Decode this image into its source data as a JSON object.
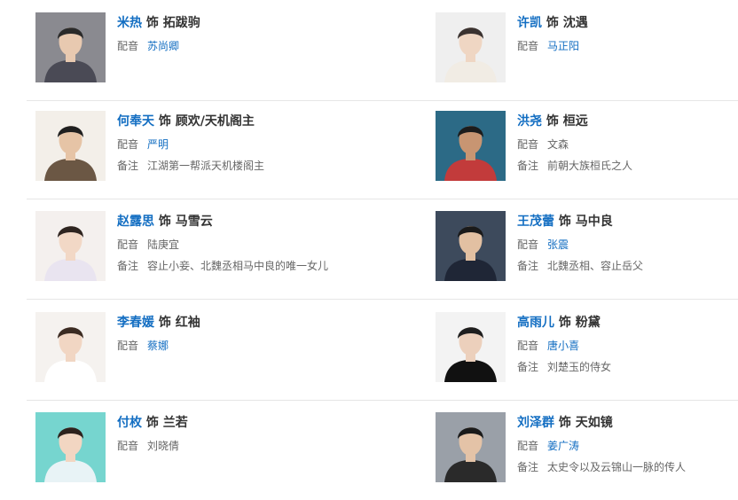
{
  "cast": [
    {
      "actor": "米热",
      "as": "饰",
      "role": "拓跋驹",
      "voice_label": "配音",
      "voice": "苏尚卿",
      "voice_link": true,
      "note_label": "",
      "note": "",
      "bg": "#8a8a90",
      "skin": "#e8c9b0",
      "hair": "#2a2a2a",
      "cloth": "#4a4a55"
    },
    {
      "actor": "许凯",
      "as": "饰",
      "role": "沈遇",
      "voice_label": "配音",
      "voice": "马正阳",
      "voice_link": true,
      "note_label": "",
      "note": "",
      "bg": "#efefef",
      "skin": "#efd6c3",
      "hair": "#3a3230",
      "cloth": "#f1ece4"
    },
    {
      "actor": "何奉天",
      "as": "饰",
      "role": "顾欢/天机阁主",
      "voice_label": "配音",
      "voice": "严明",
      "voice_link": true,
      "note_label": "备注",
      "note": "江湖第一帮派天机楼阁主",
      "bg": "#f3efe9",
      "skin": "#e6c4a6",
      "hair": "#1f1f1f",
      "cloth": "#6b5744"
    },
    {
      "actor": "洪尧",
      "as": "饰",
      "role": "桓远",
      "voice_label": "配音",
      "voice": "文森",
      "voice_link": false,
      "note_label": "备注",
      "note": "前朝大族桓氏之人",
      "bg": "#2c6a86",
      "skin": "#c89572",
      "hair": "#1c1c1c",
      "cloth": "#c23b3b"
    },
    {
      "actor": "赵露思",
      "as": "饰",
      "role": "马雪云",
      "voice_label": "配音",
      "voice": "陆庚宜",
      "voice_link": false,
      "note_label": "备注",
      "note": "容止小妾、北魏丞相马中良的唯一女儿",
      "bg": "#f4f0ee",
      "skin": "#f2d8c6",
      "hair": "#2e2420",
      "cloth": "#e9e4f0"
    },
    {
      "actor": "王茂蕾",
      "as": "饰",
      "role": "马中良",
      "voice_label": "配音",
      "voice": "张震",
      "voice_link": true,
      "note_label": "备注",
      "note": "北魏丞相、容止岳父",
      "bg": "#3d4a5c",
      "skin": "#e2c0a2",
      "hair": "#1a1a1a",
      "cloth": "#1f2636"
    },
    {
      "actor": "李春媛",
      "as": "饰",
      "role": "红袖",
      "voice_label": "配音",
      "voice": "蔡娜",
      "voice_link": true,
      "note_label": "",
      "note": "",
      "bg": "#f5f2ef",
      "skin": "#f1d6c3",
      "hair": "#3b2b22",
      "cloth": "#ffffff"
    },
    {
      "actor": "高雨儿",
      "as": "饰",
      "role": "粉黛",
      "voice_label": "配音",
      "voice": "唐小喜",
      "voice_link": true,
      "note_label": "备注",
      "note": "刘楚玉的侍女",
      "bg": "#f3f3f3",
      "skin": "#ecd0bc",
      "hair": "#1e1e1e",
      "cloth": "#111111"
    },
    {
      "actor": "付枚",
      "as": "饰",
      "role": "兰若",
      "voice_label": "配音",
      "voice": "刘晓倩",
      "voice_link": false,
      "note_label": "",
      "note": "",
      "bg": "#76d5cf",
      "skin": "#f2d6c2",
      "hair": "#2d221d",
      "cloth": "#e8f3f6"
    },
    {
      "actor": "刘泽群",
      "as": "饰",
      "role": "天如镜",
      "voice_label": "配音",
      "voice": "姜广涛",
      "voice_link": true,
      "note_label": "备注",
      "note": "太史令以及云锦山一脉的传人",
      "bg": "#9aa0a8",
      "skin": "#e4c3a7",
      "hair": "#1a1a1a",
      "cloth": "#2a2a2a"
    }
  ]
}
